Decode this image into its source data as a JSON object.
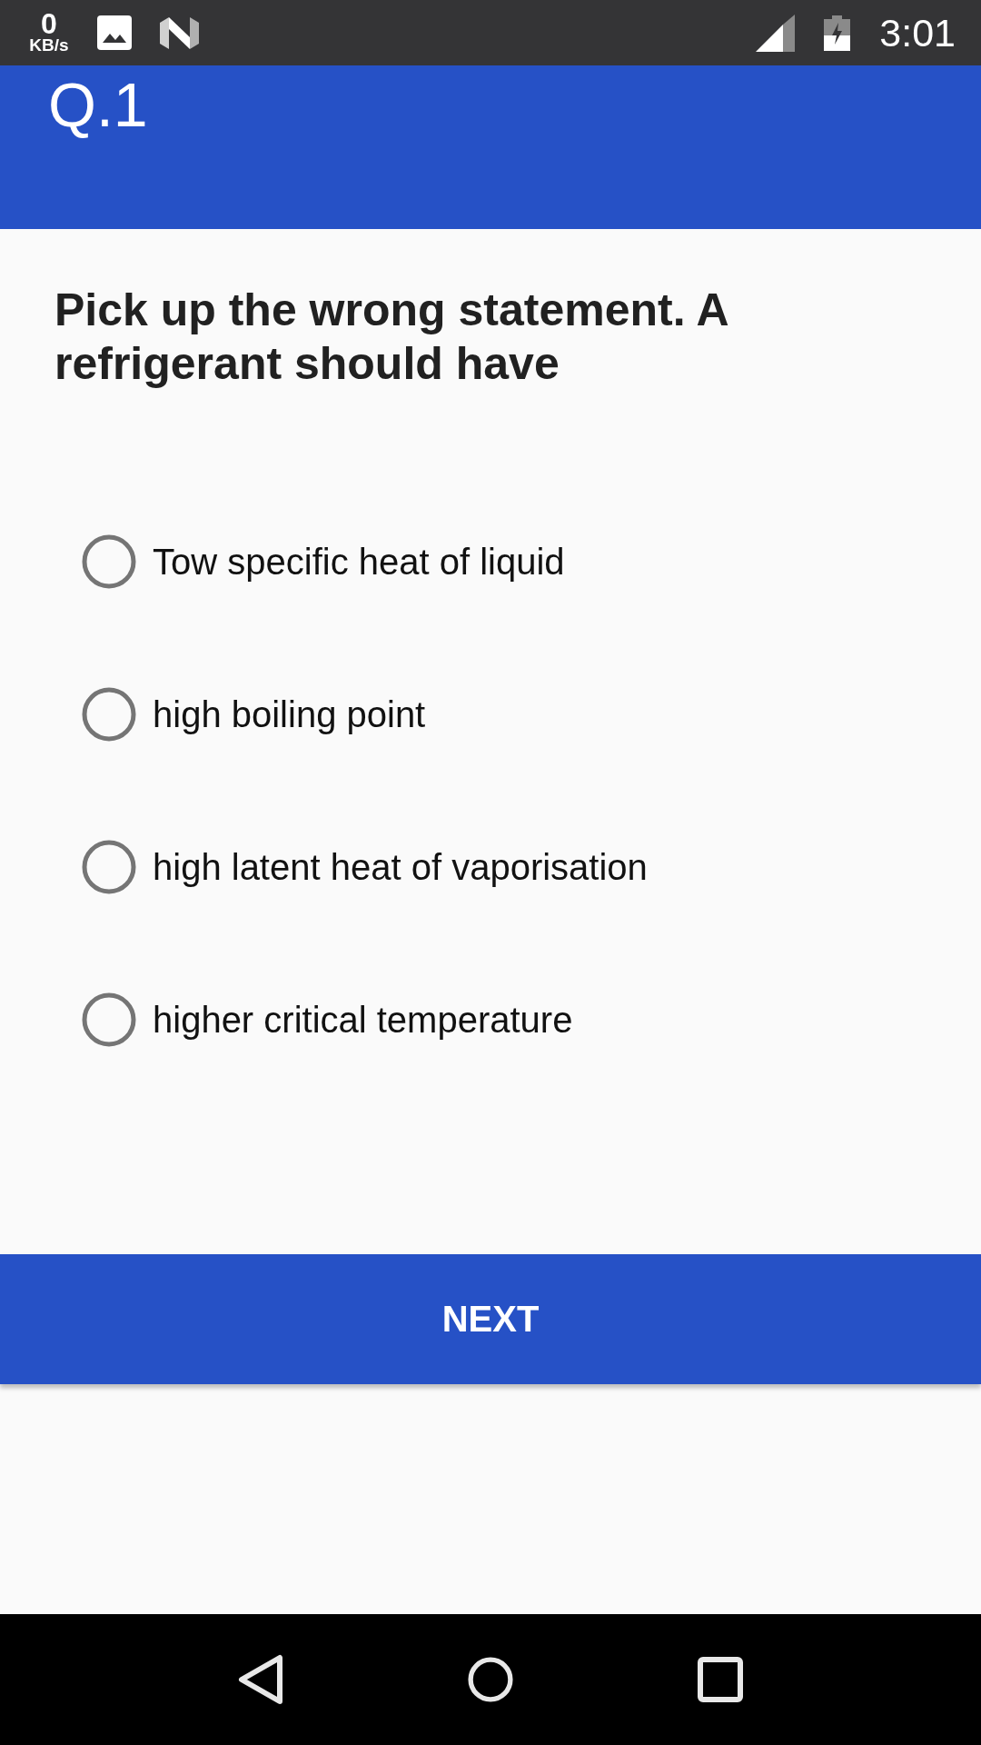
{
  "status_bar": {
    "network_speed": "0",
    "network_speed_unit": "KB/s",
    "time": "3:01"
  },
  "app_bar": {
    "title": "Q.1"
  },
  "question": {
    "text": "Pick up the wrong statement. A refrigerant should have"
  },
  "options": [
    {
      "label": "Tow specific heat of liquid",
      "selected": false
    },
    {
      "label": "high boiling point",
      "selected": false
    },
    {
      "label": "high latent heat of vaporisation",
      "selected": false
    },
    {
      "label": "higher critical temperature",
      "selected": false
    }
  ],
  "next_button": {
    "label": "NEXT"
  }
}
